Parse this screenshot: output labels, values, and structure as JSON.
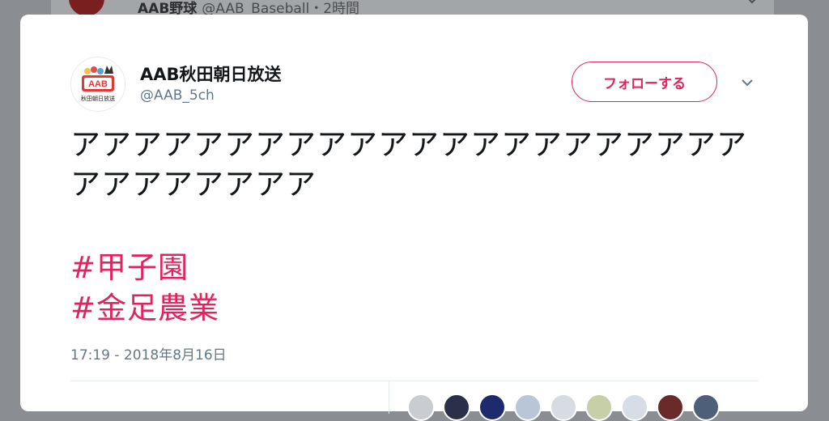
{
  "background_tweet": {
    "name": "AAB野球",
    "meta": "@AAB_Baseball・2時間"
  },
  "tweet": {
    "author": {
      "display_name": "AAB秋田朝日放送",
      "handle": "@AAB_5ch",
      "logo_text": "AAB",
      "logo_caption": "秋田朝日放送"
    },
    "follow_label": "フォローする",
    "text": "アアアアアアアアアアアアアアアアアアアアアアアアアアアアアア",
    "hashtags": [
      "#甲子園",
      "#金足農業"
    ],
    "timestamp": "17:19 - 2018年8月16日"
  },
  "colors": {
    "accent": "#e0245e",
    "text": "#14171a",
    "secondary": "#657786",
    "liker_avatars": [
      "#c9ccd0",
      "#2c2f4a",
      "#1e2a6e",
      "#b8c6d8",
      "#d6dce2",
      "#c7cfa8",
      "#d7dde6",
      "#6b2a2a",
      "#4e5f7a"
    ]
  }
}
